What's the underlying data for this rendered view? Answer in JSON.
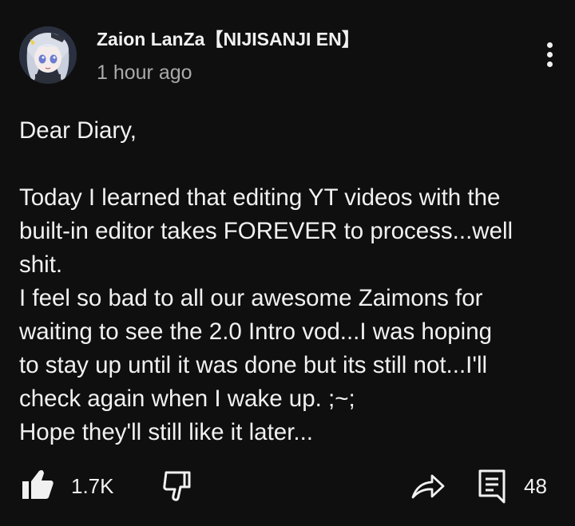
{
  "post": {
    "channel_name": "Zaion LanZa【NIJISANJI EN】",
    "timestamp": "1 hour ago",
    "body_lines": [
      "Dear Diary,",
      "",
      "Today I learned that editing YT videos with the",
      "built-in editor takes FOREVER to process...well",
      "shit.",
      "I feel so bad to all our awesome Zaimons for",
      "waiting to see the 2.0 Intro vod...I was hoping",
      "to stay up until it was done but its still not...I'll",
      "check again when I wake up. ;~;",
      "Hope they'll still like it later..."
    ]
  },
  "actions": {
    "like_count": "1.7K",
    "comment_count": "48",
    "icons": {
      "like": "thumbs-up-icon",
      "dislike": "thumbs-down-icon",
      "share": "share-icon",
      "comment": "comment-icon",
      "menu": "more-vert-icon"
    }
  },
  "colors": {
    "background": "#0f0f0f",
    "text_primary": "#f1f1f1",
    "text_secondary": "#aaaaaa"
  }
}
